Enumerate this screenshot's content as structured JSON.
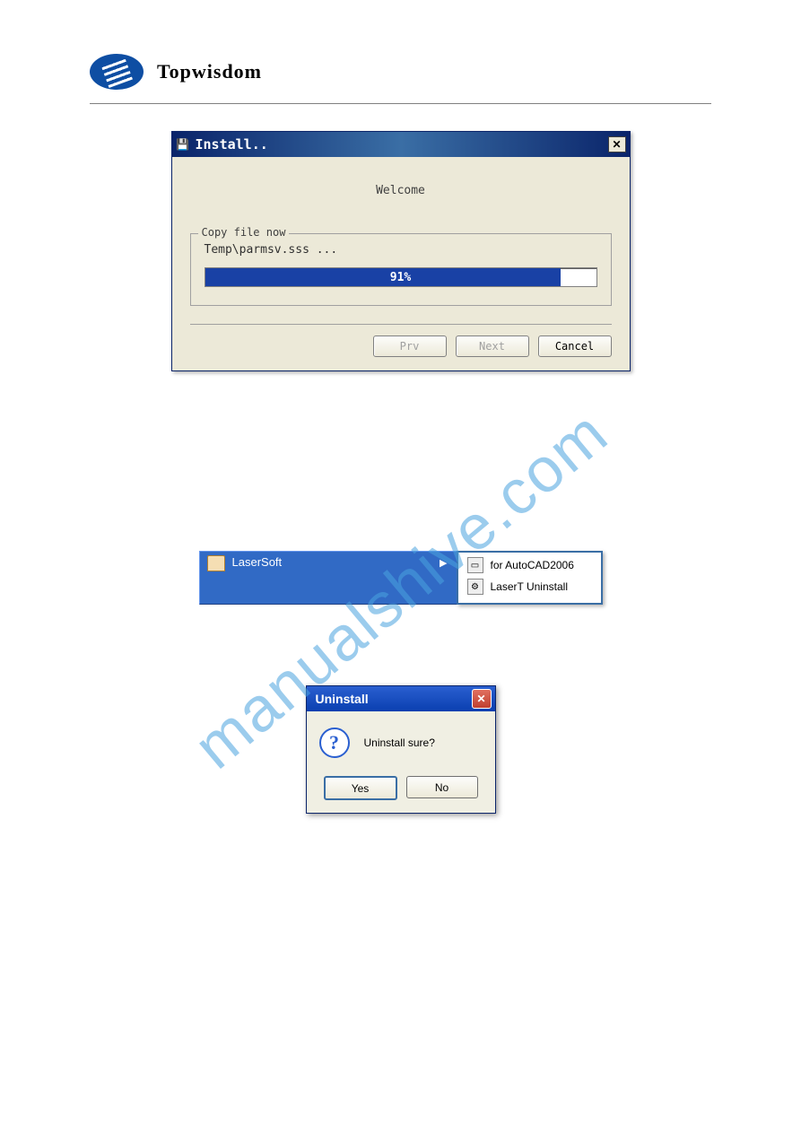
{
  "brand": "Topwisdom",
  "install": {
    "title": "Install..",
    "welcome": "Welcome",
    "fieldset_label": "Copy file now",
    "file_line": "Temp\\parmsv.sss ...",
    "progress_pct": "91%",
    "btn_prev": "Prv",
    "btn_next": "Next",
    "btn_cancel": "Cancel"
  },
  "startmenu": {
    "folder": "LaserSoft",
    "items": [
      "for AutoCAD2006",
      "LaserT Uninstall"
    ]
  },
  "uninstall": {
    "title": "Uninstall",
    "message": "Uninstall sure?",
    "btn_yes": "Yes",
    "btn_no": "No"
  },
  "watermark": "manualshive.com"
}
